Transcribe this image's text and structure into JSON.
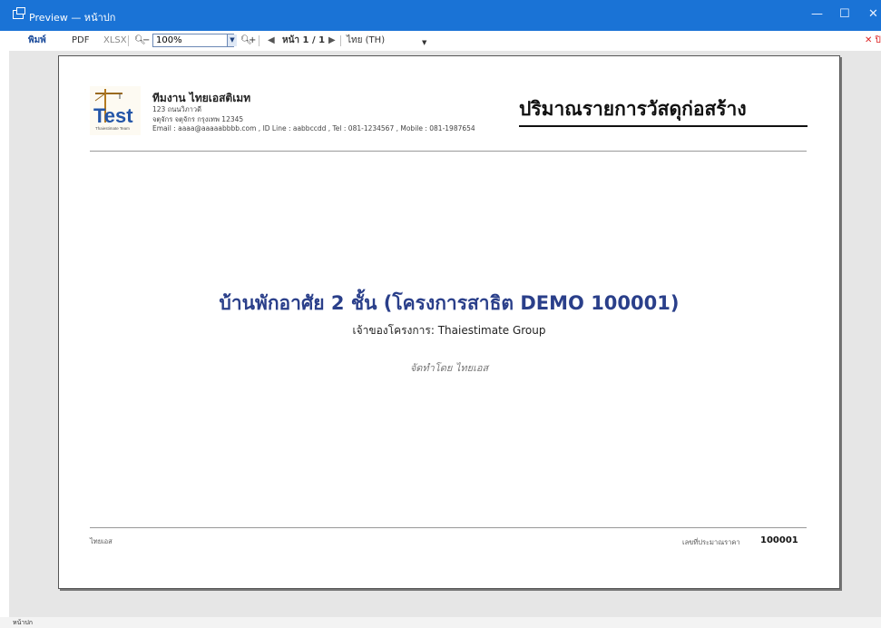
{
  "window": {
    "title": "Preview — หน้าปก",
    "minimize": "—",
    "maximize": "☐",
    "close": "✕"
  },
  "toolbar": {
    "print_label": "พิมพ์",
    "pdf_label": "PDF",
    "xlsx_label": "XLSX",
    "zoom_out_label": "−",
    "zoom_value": "100%",
    "zoom_in_label": "+",
    "page_label": "หน้า 1 / 1",
    "language": "ไทย (TH)",
    "close_label": "✕ ปิด"
  },
  "report": {
    "company_name": "ทีมงาน ไทยเอสติเมท",
    "address_line1": "123 ถนนวิภาวดี",
    "address_line2": "จตุจักร จตุจักร กรุงเทพ 12345",
    "contact_line": "Email : aaaa@aaaaabbbb.com , ID Line : aabbccdd , Tel : 081-1234567 , Mobile : 081-1987654",
    "logo_text": "Test",
    "logo_subtext": "Thaiestimate Team",
    "report_title": "ปริมาณรายการวัสดุก่อสร้าง",
    "project_title": "บ้านพักอาศัย  2  ชั้น  (โครงการสาธิต DEMO 100001)",
    "owner_line": "เจ้าของโครงการ: Thaiestimate Group",
    "prepared_by": "จัดทำโดย  ไทยเอส",
    "footer_left": "ไทยเอส",
    "footer_estimate_label": "เลขที่ประมาณราคา",
    "footer_estimate_number": "100001"
  },
  "status": {
    "text": "หน้าปก"
  },
  "colors": {
    "titlebar": "#1a73d6",
    "project_title": "#2a3f8a",
    "viewport_bg": "#e6e6e6"
  }
}
